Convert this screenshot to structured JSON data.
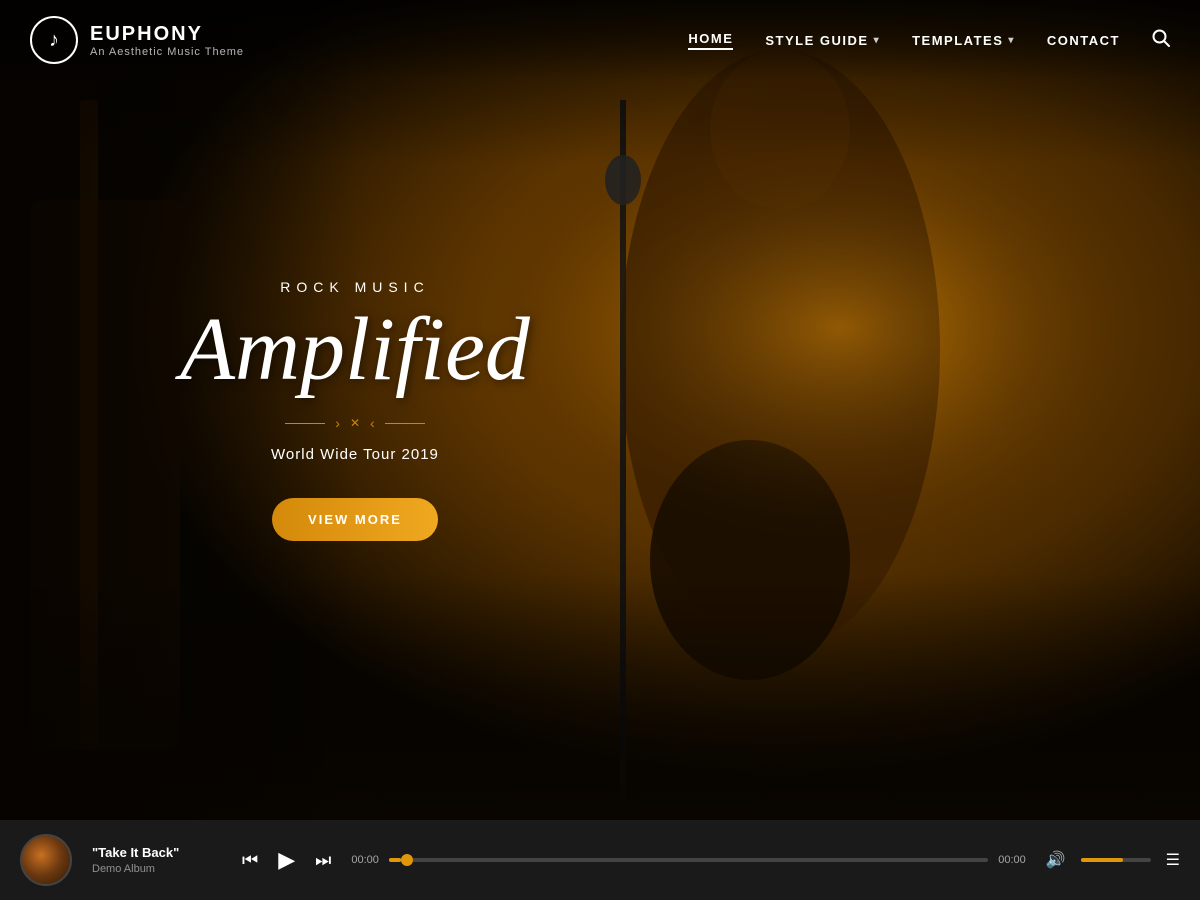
{
  "site": {
    "name": "EUPHONY",
    "tagline": "An Aesthetic Music Theme",
    "logo_char": "♪"
  },
  "nav": {
    "items": [
      {
        "label": "HOME",
        "active": true,
        "has_dropdown": false
      },
      {
        "label": "STYLE GUIDE",
        "active": false,
        "has_dropdown": true
      },
      {
        "label": "TEMPLATES",
        "active": false,
        "has_dropdown": true
      },
      {
        "label": "CONTACT",
        "active": false,
        "has_dropdown": false
      }
    ],
    "search_label": "search"
  },
  "hero": {
    "subtitle": "ROCK MUSIC",
    "title": "Amplified",
    "divider_char": "✕",
    "description": "World Wide Tour 2019",
    "cta_label": "VIEW MORE"
  },
  "player": {
    "track_name": "\"Take It Back\"",
    "album_name": "Demo Album",
    "time_current": "00:00",
    "time_total": "00:00",
    "progress_percent": 2,
    "volume_percent": 60
  },
  "colors": {
    "accent": "#e0970a",
    "dark": "#1a1a1a",
    "amber": "#c87020"
  }
}
